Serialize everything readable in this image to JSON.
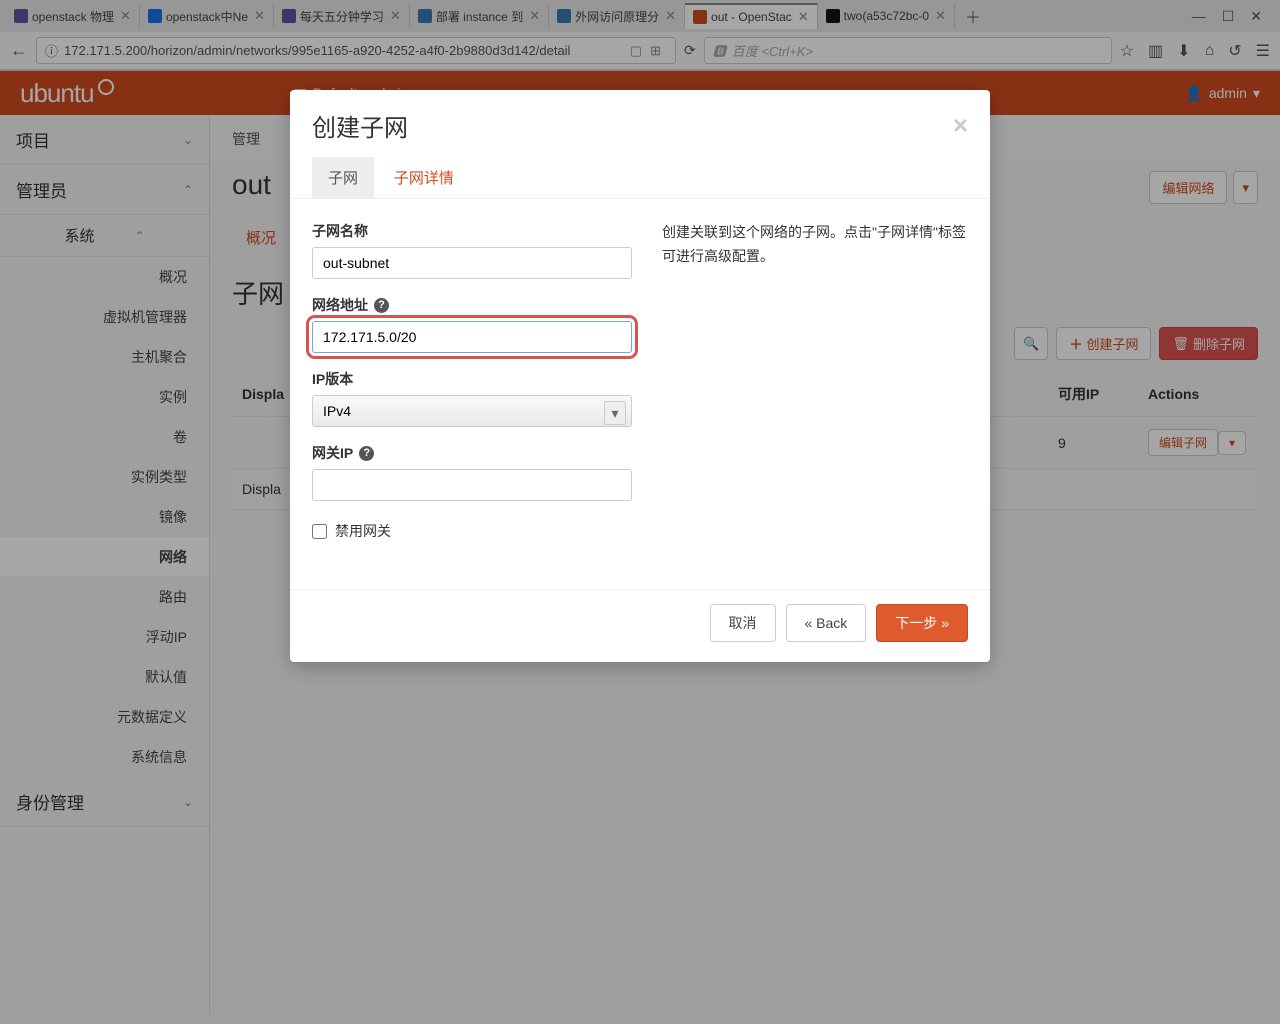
{
  "browser": {
    "tabs": [
      {
        "label": "openstack 物理",
        "favicon": "#5a55a3"
      },
      {
        "label": "openstack中Ne",
        "favicon": "#1a73e8"
      },
      {
        "label": "每天五分钟学习",
        "favicon": "#5a55a3"
      },
      {
        "label": "部署 instance 到",
        "favicon": "#3b78b4"
      },
      {
        "label": "外网访问原理分",
        "favicon": "#3b78b4"
      },
      {
        "label": "out - OpenStac",
        "favicon": "#d04c1f",
        "active": true
      },
      {
        "label": "two(a53c72bc-0",
        "favicon": "#111"
      }
    ],
    "url": "172.171.5.200/horizon/admin/networks/995e1165-a920-4252-a4f0-2b9880d3d142/detail",
    "search_placeholder": "百度 <Ctrl+K>"
  },
  "header": {
    "logo": "ubuntu",
    "domain": "Default • admin",
    "user": "admin"
  },
  "sidebar": {
    "project": "项目",
    "admin": "管理员",
    "system": "系统",
    "items": [
      "概况",
      "虚拟机管理器",
      "主机聚合",
      "实例",
      "卷",
      "实例类型",
      "镜像",
      "网络",
      "路由",
      "浮动IP",
      "默认值",
      "元数据定义",
      "系统信息"
    ],
    "active_item": "网络",
    "identity": "身份管理"
  },
  "page": {
    "breadcrumb": "管理",
    "title": "out",
    "edit_network": "编辑网络",
    "tab_overview": "概况",
    "section_title": "子网",
    "create_subnet": "创建子网",
    "delete_subnet": "删除子网",
    "col_display": "Displa",
    "col_available": "可用IP",
    "col_actions": "Actions",
    "row_available": "9",
    "row_action": "编辑子网",
    "footer": "Displa"
  },
  "modal": {
    "title": "创建子网",
    "tab_subnet": "子网",
    "tab_detail": "子网详情",
    "label_name": "子网名称",
    "value_name": "out-subnet",
    "label_cidr": "网络地址",
    "value_cidr": "172.171.5.0/20",
    "label_ipver": "IP版本",
    "value_ipver": "IPv4",
    "label_gateway": "网关IP",
    "value_gateway": "",
    "label_disable_gw": "禁用网关",
    "desc": "创建关联到这个网络的子网。点击\"子网详情\"标签可进行高级配置。",
    "btn_cancel": "取消",
    "btn_back": "«  Back",
    "btn_next": "下一步  »"
  }
}
